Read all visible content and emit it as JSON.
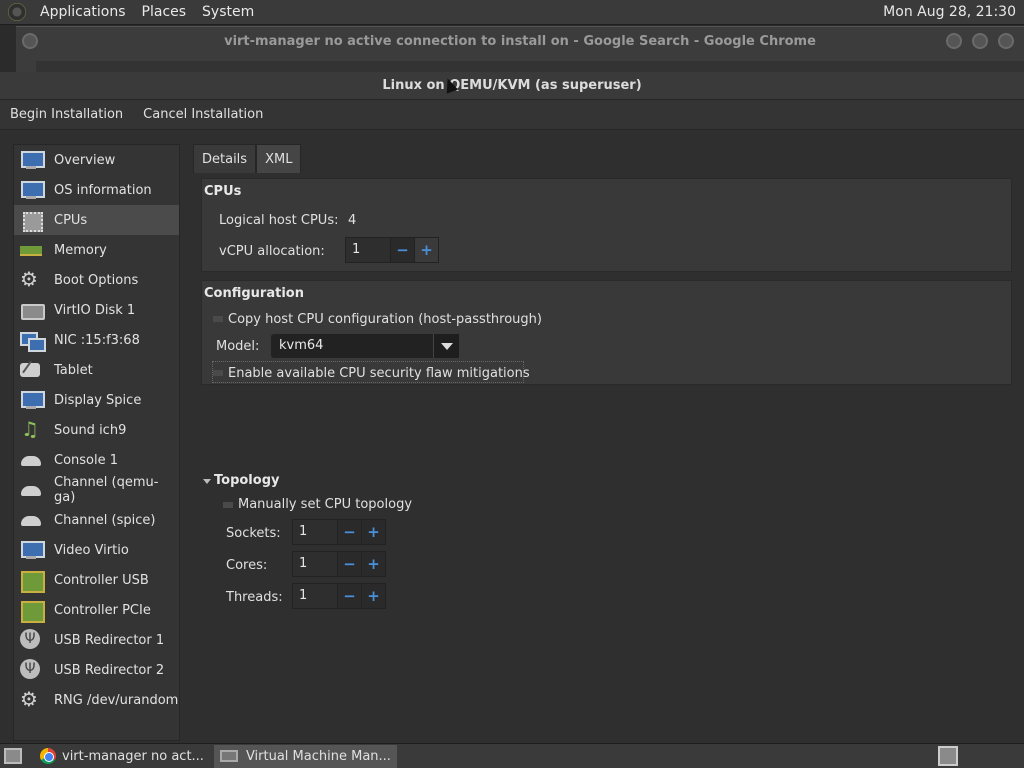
{
  "top_panel": {
    "menus": [
      "Applications",
      "Places",
      "System"
    ],
    "clock": "Mon Aug 28, 21:30"
  },
  "chrome_window": {
    "title": "virt-manager no active connection to install on - Google Search - Google Chrome"
  },
  "window": {
    "title": "Linux on QEMU/KVM (as superuser)"
  },
  "toolbar": {
    "begin_label": "Begin Installation",
    "cancel_label": "Cancel Installation"
  },
  "sidebar": {
    "selected": "CPUs",
    "items": [
      {
        "label": "Overview",
        "icon": "monitor-icon"
      },
      {
        "label": "OS information",
        "icon": "monitor-icon"
      },
      {
        "label": "CPUs",
        "icon": "chip-icon"
      },
      {
        "label": "Memory",
        "icon": "memory-icon"
      },
      {
        "label": "Boot Options",
        "icon": "gears-icon"
      },
      {
        "label": "VirtIO Disk 1",
        "icon": "disk-icon"
      },
      {
        "label": "NIC :15:f3:68",
        "icon": "network-icon"
      },
      {
        "label": "Tablet",
        "icon": "tablet-icon"
      },
      {
        "label": "Display Spice",
        "icon": "monitor-icon"
      },
      {
        "label": "Sound ich9",
        "icon": "sound-icon"
      },
      {
        "label": "Console 1",
        "icon": "console-icon"
      },
      {
        "label": "Channel (qemu-ga)",
        "icon": "console-icon"
      },
      {
        "label": "Channel (spice)",
        "icon": "console-icon"
      },
      {
        "label": "Video Virtio",
        "icon": "monitor-icon"
      },
      {
        "label": "Controller USB",
        "icon": "board-icon"
      },
      {
        "label": "Controller PCIe",
        "icon": "board-icon"
      },
      {
        "label": "USB Redirector 1",
        "icon": "usb-icon"
      },
      {
        "label": "USB Redirector 2",
        "icon": "usb-icon"
      },
      {
        "label": "RNG /dev/urandom",
        "icon": "gears-icon"
      }
    ]
  },
  "tabs": {
    "details": "Details",
    "xml": "XML"
  },
  "cpus": {
    "title": "CPUs",
    "logical_label": "Logical host CPUs:",
    "logical_value": "4",
    "vcpu_label": "vCPU allocation:",
    "vcpu_value": "1"
  },
  "configuration": {
    "title": "Configuration",
    "copy_host_label": "Copy host CPU configuration (host-passthrough)",
    "model_label": "Model:",
    "model_value": "kvm64",
    "mitigations_label": "Enable available CPU security flaw mitigations"
  },
  "topology": {
    "title": "Topology",
    "manual_label": "Manually set CPU topology",
    "sockets_label": "Sockets:",
    "sockets_value": "1",
    "cores_label": "Cores:",
    "cores_value": "1",
    "threads_label": "Threads:",
    "threads_value": "1"
  },
  "spin": {
    "minus": "−",
    "plus": "+"
  },
  "taskbar": {
    "chrome_task": "virt-manager no act...",
    "vm_task": "Virtual Machine Man..."
  },
  "colors": {
    "accent": "#4a90d9",
    "panel_bg": "#3a3a3a",
    "window_bg": "#2f2f2f"
  }
}
